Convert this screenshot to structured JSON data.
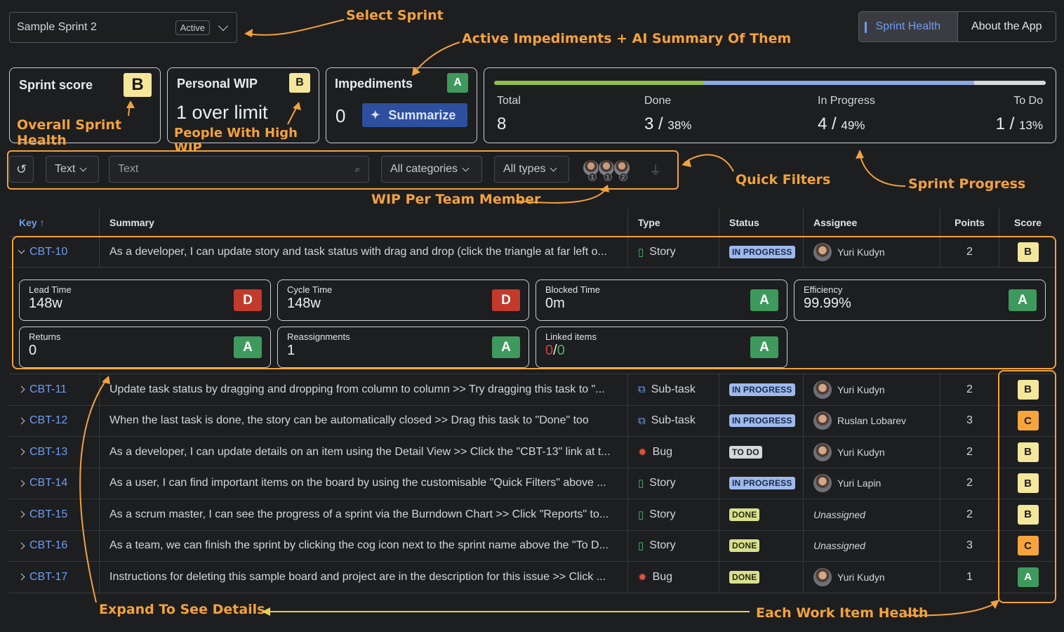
{
  "sprint_select": {
    "name": "Sample Sprint 2",
    "badge": "Active"
  },
  "nav": {
    "tabs": [
      "Sprint Health",
      "About the App"
    ]
  },
  "cards": {
    "sprint_score": {
      "title": "Sprint score",
      "grade": "B",
      "annotation": "Overall Sprint Health"
    },
    "personal_wip": {
      "title": "Personal WIP",
      "grade": "B",
      "value": "1 over limit",
      "annotation": "People With High WIP"
    },
    "impediments": {
      "title": "Impediments",
      "grade": "A",
      "value": "0",
      "button": "Summarize"
    }
  },
  "progress": {
    "total_label": "Total",
    "total_value": "8",
    "done_label": "Done",
    "done_value": "3 /",
    "done_pct": "38%",
    "inprog_label": "In Progress",
    "inprog_value": "4 /",
    "inprog_pct": "49%",
    "todo_label": "To Do",
    "todo_value": "1 /",
    "todo_pct": "13%",
    "fractions": {
      "done": 0.38,
      "in_progress": 0.49,
      "to_do": 0.13
    },
    "colors": {
      "done": "#8fc14a",
      "in_progress": "#8aa8e6",
      "to_do": "#d8d9dc"
    }
  },
  "filters": {
    "text_select": "Text",
    "search_placeholder": "Text",
    "categories": "All categories",
    "types": "All types",
    "wip_avatars": [
      "1",
      "1",
      "2"
    ]
  },
  "annotations": {
    "select_sprint": "Select Sprint",
    "impediments_ai": "Active Impediments + AI Summary Of Them",
    "quick_filters": "Quick Filters",
    "sprint_progress": "Sprint Progress",
    "wip_per_member": "WIP Per Team Member",
    "expand": "Expand  To See  Details",
    "item_health": "Each Work Item Health"
  },
  "table": {
    "headers": {
      "key": "Key ↑",
      "summary": "Summary",
      "type": "Type",
      "status": "Status",
      "assignee": "Assignee",
      "points": "Points",
      "score": "Score"
    },
    "rows": [
      {
        "key": "CBT-10",
        "summary": "As a developer, I can update story and task status with drag and drop (click the triangle at far left o...",
        "type": "Story",
        "status": "IN PROGRESS",
        "assignee": "Yuri Kudyn",
        "points": "2",
        "score": "B"
      },
      {
        "key": "CBT-11",
        "summary": "Update task status by dragging and dropping from column to column >> Try dragging this task to \"...",
        "type": "Sub-task",
        "status": "IN PROGRESS",
        "assignee": "Yuri Kudyn",
        "points": "2",
        "score": "B"
      },
      {
        "key": "CBT-12",
        "summary": "When the last task is done, the story can be automatically closed >> Drag this task to \"Done\" too",
        "type": "Sub-task",
        "status": "IN PROGRESS",
        "assignee": "Ruslan Lobarev",
        "points": "3",
        "score": "C"
      },
      {
        "key": "CBT-13",
        "summary": "As a developer, I can update details on an item using the Detail View >> Click the \"CBT-13\" link at t...",
        "type": "Bug",
        "status": "TO DO",
        "assignee": "Yuri Kudyn",
        "points": "2",
        "score": "B"
      },
      {
        "key": "CBT-14",
        "summary": "As a user, I can find important items on the board by using the customisable \"Quick Filters\" above ...",
        "type": "Story",
        "status": "IN PROGRESS",
        "assignee": "Yuri Lapin",
        "points": "2",
        "score": "B"
      },
      {
        "key": "CBT-15",
        "summary": "As a scrum master, I can see the progress of a sprint via the Burndown Chart >> Click \"Reports\" to...",
        "type": "Story",
        "status": "DONE",
        "assignee": "Unassigned",
        "points": "2",
        "score": "B"
      },
      {
        "key": "CBT-16",
        "summary": "As a team, we can finish the sprint by clicking the cog icon next to the sprint name above the \"To D...",
        "type": "Story",
        "status": "DONE",
        "assignee": "Unassigned",
        "points": "3",
        "score": "C"
      },
      {
        "key": "CBT-17",
        "summary": "Instructions for deleting this sample board and project are in the description for this issue >> Click ...",
        "type": "Bug",
        "status": "DONE",
        "assignee": "Yuri Kudyn",
        "points": "1",
        "score": "A"
      }
    ]
  },
  "details": {
    "lead_time": {
      "label": "Lead Time",
      "value": "148w",
      "grade": "D"
    },
    "cycle_time": {
      "label": "Cycle Time",
      "value": "148w",
      "grade": "D"
    },
    "blocked_time": {
      "label": "Blocked Time",
      "value": "0m",
      "grade": "A"
    },
    "efficiency": {
      "label": "Efficiency",
      "value": "99.99%",
      "grade": "A"
    },
    "returns": {
      "label": "Returns",
      "value": "0",
      "grade": "A"
    },
    "reassignments": {
      "label": "Reassignments",
      "value": "1",
      "grade": "A"
    },
    "linked_items": {
      "label": "Linked items",
      "value_a": "0",
      "sep": "/",
      "value_b": "0",
      "grade": "A"
    }
  }
}
